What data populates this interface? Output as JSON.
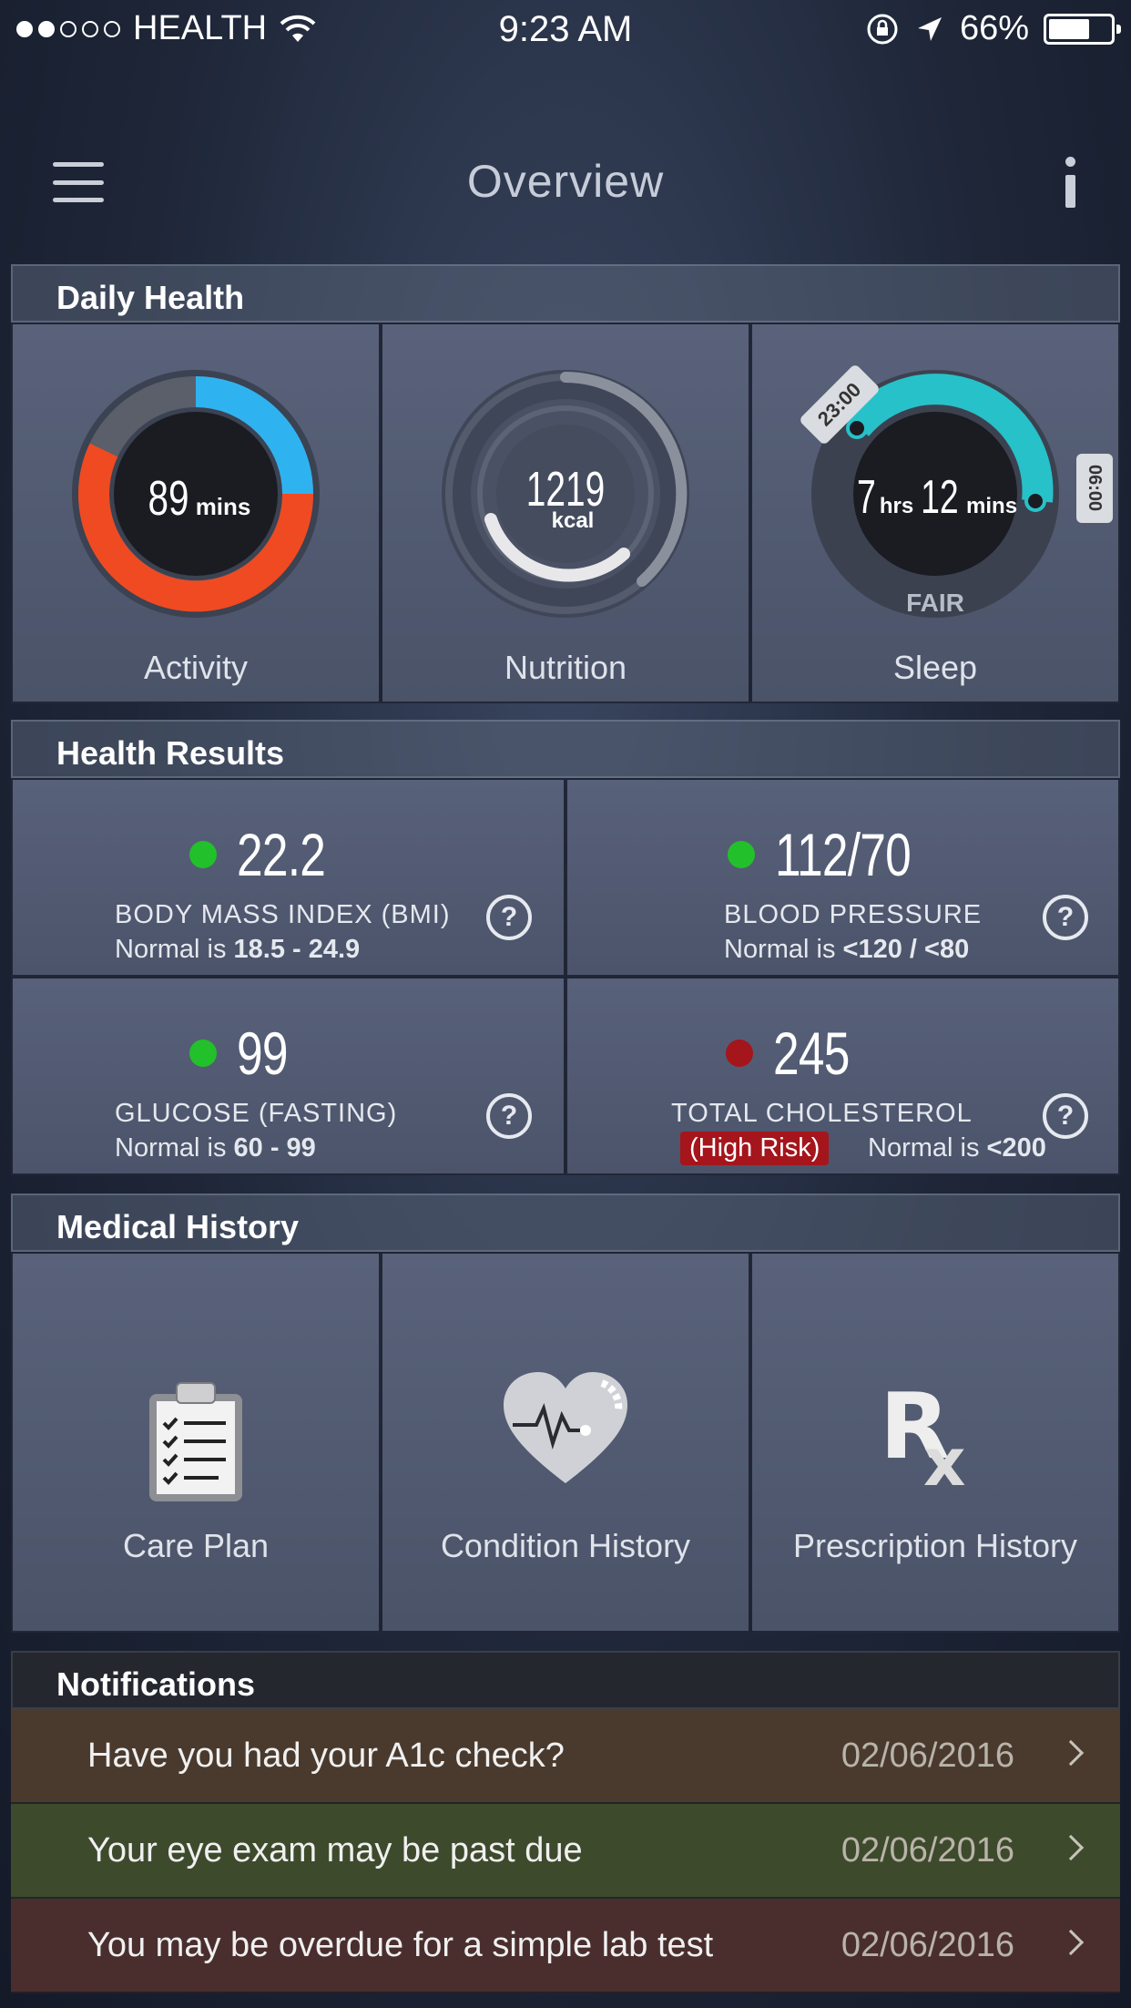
{
  "status_bar": {
    "carrier": "HEALTH",
    "time": "9:23 AM",
    "battery": "66%",
    "battery_level": 0.66,
    "signal_bars": 2
  },
  "nav": {
    "title": "Overview",
    "menu_icon": "hamburger-menu-icon",
    "info_icon": "info-icon"
  },
  "daily_health": {
    "title": "Daily Health",
    "activity": {
      "label": "Activity",
      "value": "89",
      "unit": "mins"
    },
    "nutrition": {
      "label": "Nutrition",
      "value": "1219",
      "unit": "kcal"
    },
    "sleep": {
      "label": "Sleep",
      "hours": "7",
      "hours_unit": "hrs",
      "minutes": "12",
      "minutes_unit": "mins",
      "quality": "FAIR",
      "start_time": "23:00",
      "end_time": "06:00"
    }
  },
  "health_results": {
    "title": "Health Results",
    "items": [
      {
        "value": "22.2",
        "name": "BODY MASS INDEX (BMI)",
        "normal_prefix": "Normal is ",
        "normal_range": "18.5 - 24.9",
        "status_color": "#22c02a"
      },
      {
        "value": "112/70",
        "name": "BLOOD PRESSURE",
        "normal_prefix": "Normal is ",
        "normal_range": "<120 / <80",
        "status_color": "#22c02a"
      },
      {
        "value": "99",
        "name": "GLUCOSE (FASTING)",
        "normal_prefix": "Normal is ",
        "normal_range": "60 - 99",
        "status_color": "#22c02a"
      },
      {
        "value": "245",
        "name": "TOTAL CHOLESTEROL",
        "normal_prefix": "Normal is ",
        "normal_range": "<200",
        "status_color": "#a5151c",
        "risk": "(High Risk)"
      }
    ]
  },
  "medical_history": {
    "title": "Medical History",
    "items": [
      {
        "label": "Care Plan",
        "icon": "clipboard-checklist-icon"
      },
      {
        "label": "Condition History",
        "icon": "heart-pulse-icon"
      },
      {
        "label": "Prescription History",
        "icon": "rx-icon"
      }
    ]
  },
  "notifications": {
    "title": "Notifications",
    "items": [
      {
        "text": "Have you had your A1c check?",
        "date": "02/06/2016",
        "bg": "#4a3a2e"
      },
      {
        "text": "Your eye exam may be past due",
        "date": "02/06/2016",
        "bg": "#3e4a2c"
      },
      {
        "text": "You may be overdue for a simple lab test",
        "date": "02/06/2016",
        "bg": "#4a2e2e"
      }
    ]
  }
}
